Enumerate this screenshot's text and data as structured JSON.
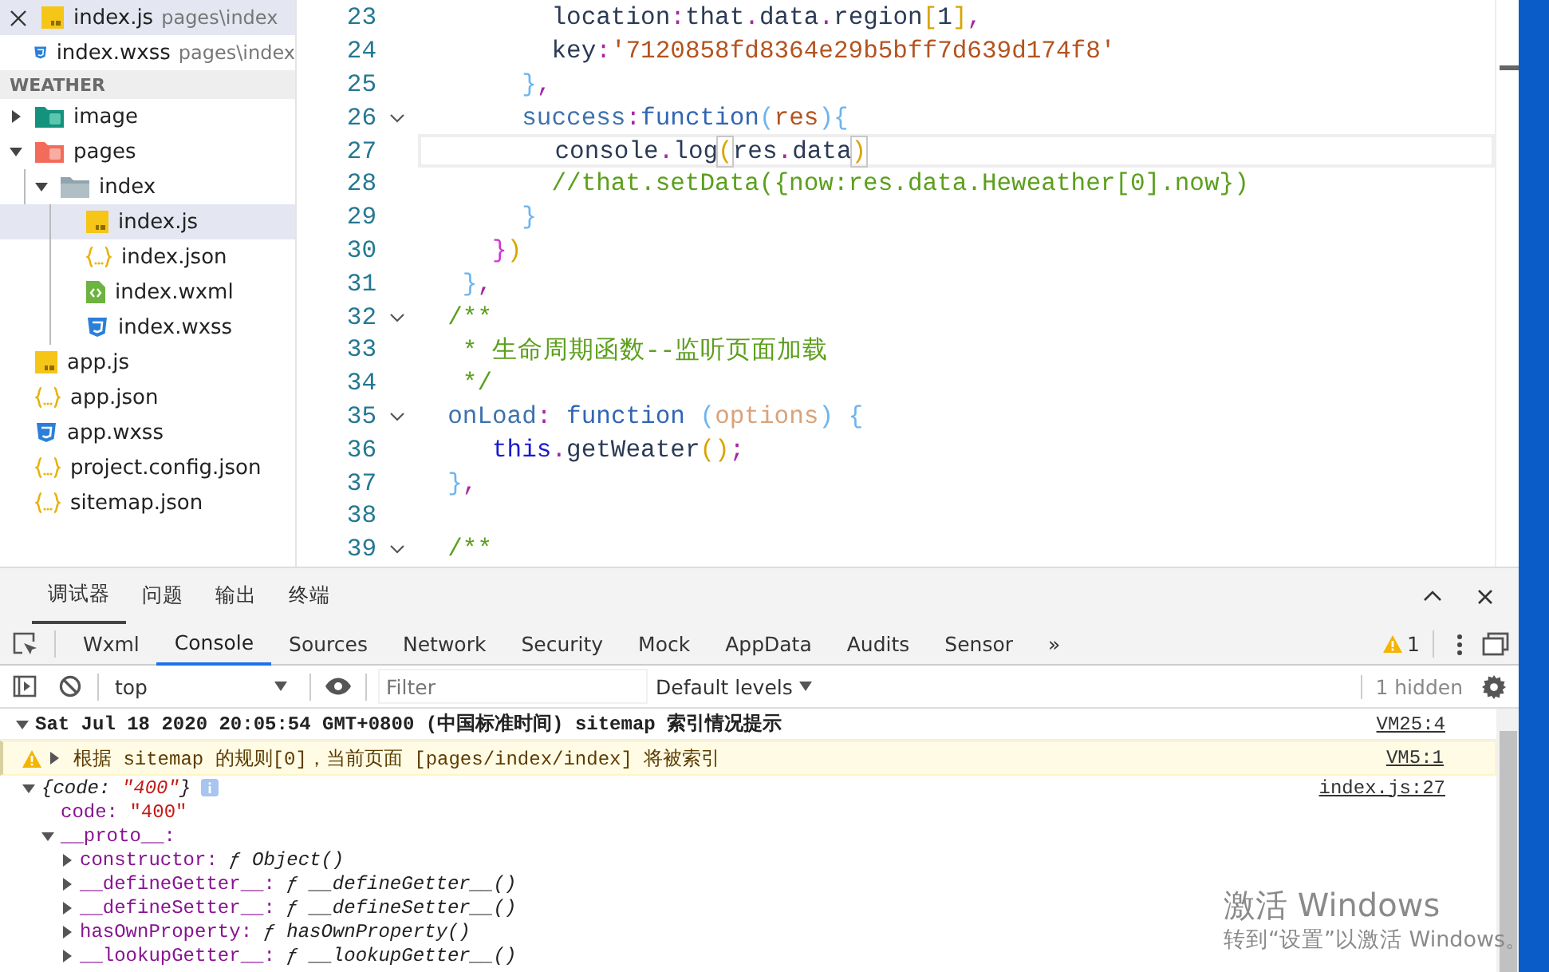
{
  "open_editors": [
    {
      "name": "index.js",
      "path": "pages\\index",
      "kind": "js",
      "selected": true,
      "closable": true
    },
    {
      "name": "index.wxss",
      "path": "pages\\index",
      "kind": "css",
      "selected": false,
      "closable": false
    }
  ],
  "explorer": {
    "title": "WEATHER",
    "tree": [
      {
        "name": "image",
        "kind": "image-folder",
        "expanded": false,
        "selected": false
      },
      {
        "name": "pages",
        "kind": "pages-folder",
        "expanded": true,
        "selected": false,
        "children": [
          {
            "name": "index",
            "kind": "folder",
            "expanded": true,
            "selected": false,
            "children": [
              {
                "name": "index.js",
                "kind": "js",
                "selected": true
              },
              {
                "name": "index.json",
                "kind": "json",
                "selected": false
              },
              {
                "name": "index.wxml",
                "kind": "wxml",
                "selected": false
              },
              {
                "name": "index.wxss",
                "kind": "css",
                "selected": false
              }
            ]
          }
        ]
      },
      {
        "name": "app.js",
        "kind": "js",
        "selected": false
      },
      {
        "name": "app.json",
        "kind": "json",
        "selected": false
      },
      {
        "name": "app.wxss",
        "kind": "css",
        "selected": false
      },
      {
        "name": "project.config.json",
        "kind": "json",
        "selected": false
      },
      {
        "name": "sitemap.json",
        "kind": "json",
        "selected": false
      }
    ]
  },
  "editor": {
    "lines": [
      {
        "number": "23",
        "fold": false,
        "current": false,
        "tokens": [
          {
            "text": "         location",
            "kind": "plain"
          },
          {
            "text": ":",
            "kind": "punct"
          },
          {
            "text": "that",
            "kind": "plain"
          },
          {
            "text": ".",
            "kind": "punct"
          },
          {
            "text": "data",
            "kind": "plain"
          },
          {
            "text": ".",
            "kind": "punct"
          },
          {
            "text": "region",
            "kind": "plain"
          },
          {
            "text": "[",
            "kind": "bracket"
          },
          {
            "text": "1",
            "kind": "plain"
          },
          {
            "text": "]",
            "kind": "bracket"
          },
          {
            "text": ",",
            "kind": "punct"
          }
        ]
      },
      {
        "number": "24",
        "fold": false,
        "current": false,
        "tokens": [
          {
            "text": "         key",
            "kind": "plain"
          },
          {
            "text": ":",
            "kind": "punct"
          },
          {
            "text": "'7120858fd8364e29b5bff7d639d174f8'",
            "kind": "string"
          }
        ]
      },
      {
        "number": "25",
        "fold": false,
        "current": false,
        "tokens": [
          {
            "text": "       }",
            "kind": "brace"
          },
          {
            "text": ",",
            "kind": "punct"
          }
        ]
      },
      {
        "number": "26",
        "fold": true,
        "current": false,
        "tokens": [
          {
            "text": "       success",
            "kind": "prop"
          },
          {
            "text": ":",
            "kind": "punct"
          },
          {
            "text": "function",
            "kind": "keyword"
          },
          {
            "text": "(",
            "kind": "brace"
          },
          {
            "text": "res",
            "kind": "param"
          },
          {
            "text": "){",
            "kind": "brace"
          }
        ]
      },
      {
        "number": "27",
        "fold": false,
        "current": true,
        "tokens": [
          {
            "text": "         console",
            "kind": "plain"
          },
          {
            "text": ".",
            "kind": "punct"
          },
          {
            "text": "log",
            "kind": "plain"
          },
          {
            "text": "(",
            "kind": "match"
          },
          {
            "text": "res",
            "kind": "plain"
          },
          {
            "text": ".",
            "kind": "punct"
          },
          {
            "text": "data",
            "kind": "plain"
          },
          {
            "text": ")",
            "kind": "match"
          }
        ]
      },
      {
        "number": "28",
        "fold": false,
        "current": false,
        "tokens": [
          {
            "text": "         //that.setData({now:res.data.Heweather[0].now})",
            "kind": "comment"
          }
        ]
      },
      {
        "number": "29",
        "fold": false,
        "current": false,
        "tokens": [
          {
            "text": "       }",
            "kind": "brace"
          }
        ]
      },
      {
        "number": "30",
        "fold": false,
        "current": false,
        "tokens": [
          {
            "text": "     }",
            "kind": "brace2"
          },
          {
            "text": ")",
            "kind": "bracket"
          }
        ]
      },
      {
        "number": "31",
        "fold": false,
        "current": false,
        "tokens": [
          {
            "text": "   }",
            "kind": "brace"
          },
          {
            "text": ",",
            "kind": "punct"
          }
        ]
      },
      {
        "number": "32",
        "fold": true,
        "current": false,
        "tokens": [
          {
            "text": "  /**",
            "kind": "comment"
          }
        ]
      },
      {
        "number": "33",
        "fold": false,
        "current": false,
        "tokens": [
          {
            "text": "   * 生命周期函数--监听页面加载",
            "kind": "comment"
          }
        ]
      },
      {
        "number": "34",
        "fold": false,
        "current": false,
        "tokens": [
          {
            "text": "   */",
            "kind": "comment"
          }
        ]
      },
      {
        "number": "35",
        "fold": true,
        "current": false,
        "tokens": [
          {
            "text": "  onLoad",
            "kind": "prop"
          },
          {
            "text": ":",
            "kind": "punct"
          },
          {
            "text": " function",
            "kind": "keyword"
          },
          {
            "text": " (",
            "kind": "brace"
          },
          {
            "text": "options",
            "kind": "param2"
          },
          {
            "text": ") {",
            "kind": "brace"
          }
        ]
      },
      {
        "number": "36",
        "fold": false,
        "current": false,
        "tokens": [
          {
            "text": "     this",
            "kind": "this"
          },
          {
            "text": ".",
            "kind": "punct"
          },
          {
            "text": "getWeater",
            "kind": "plain"
          },
          {
            "text": "()",
            "kind": "bracket"
          },
          {
            "text": ";",
            "kind": "punct"
          }
        ]
      },
      {
        "number": "37",
        "fold": false,
        "current": false,
        "tokens": [
          {
            "text": "  }",
            "kind": "brace"
          },
          {
            "text": ",",
            "kind": "punct"
          }
        ]
      },
      {
        "number": "38",
        "fold": false,
        "current": false
      },
      {
        "number": "39",
        "fold": true,
        "current": false,
        "tokens": [
          {
            "text": "  /**",
            "kind": "comment"
          }
        ]
      }
    ]
  },
  "devtools": {
    "panel_tabs": [
      {
        "label": "调试器",
        "selected": true
      },
      {
        "label": "问题",
        "selected": false
      },
      {
        "label": "输出",
        "selected": false
      },
      {
        "label": "终端",
        "selected": false
      }
    ],
    "tabs": [
      {
        "label": "Wxml",
        "selected": false
      },
      {
        "label": "Console",
        "selected": true
      },
      {
        "label": "Sources",
        "selected": false
      },
      {
        "label": "Network",
        "selected": false
      },
      {
        "label": "Security",
        "selected": false
      },
      {
        "label": "Mock",
        "selected": false
      },
      {
        "label": "AppData",
        "selected": false
      },
      {
        "label": "Audits",
        "selected": false
      },
      {
        "label": "Sensor",
        "selected": false
      }
    ],
    "more_tabs": "»",
    "warnings": "1",
    "context": "top",
    "filter": {
      "placeholder": "Filter"
    },
    "levels": "Default levels",
    "hidden": "1 hidden",
    "console": [
      {
        "kind": "group",
        "expanded": true,
        "text": "Sat Jul 18 2020 20:05:54 GMT+0800 (中国标准时间) sitemap 索引情况提示",
        "source": "VM25:4"
      },
      {
        "kind": "warning",
        "expanded": false,
        "text": "根据 sitemap 的规则[0]，当前页面 [pages/index/index] 将被索引",
        "source": "VM5:1"
      },
      {
        "kind": "object",
        "expanded": true,
        "summary": [
          {
            "text": "{code: ",
            "kind": "plain"
          },
          {
            "text": "\"400\"",
            "kind": "string"
          },
          {
            "text": "}",
            "kind": "plain"
          }
        ],
        "source": "index.js:27",
        "children": [
          {
            "key": "code:",
            "value": "\"400\"",
            "kind": "string"
          },
          {
            "key": "__proto__:",
            "kind": "object",
            "expanded": true,
            "children": [
              {
                "key": "constructor:",
                "value": "ƒ Object()",
                "kind": "function",
                "expanded": false
              },
              {
                "key": "__defineGetter__:",
                "value": "ƒ __defineGetter__()",
                "kind": "function",
                "expanded": false
              },
              {
                "key": "__defineSetter__:",
                "value": "ƒ __defineSetter__()",
                "kind": "function",
                "expanded": false
              },
              {
                "key": "hasOwnProperty:",
                "value": "ƒ hasOwnProperty()",
                "kind": "function",
                "expanded": false
              },
              {
                "key": "__lookupGetter__:",
                "value": "ƒ __lookupGetter__()",
                "kind": "function",
                "expanded": false
              }
            ]
          }
        ]
      }
    ]
  },
  "os_notice": {
    "title": "激活 Windows",
    "text": "转到“设置”以激活 Windows。"
  }
}
